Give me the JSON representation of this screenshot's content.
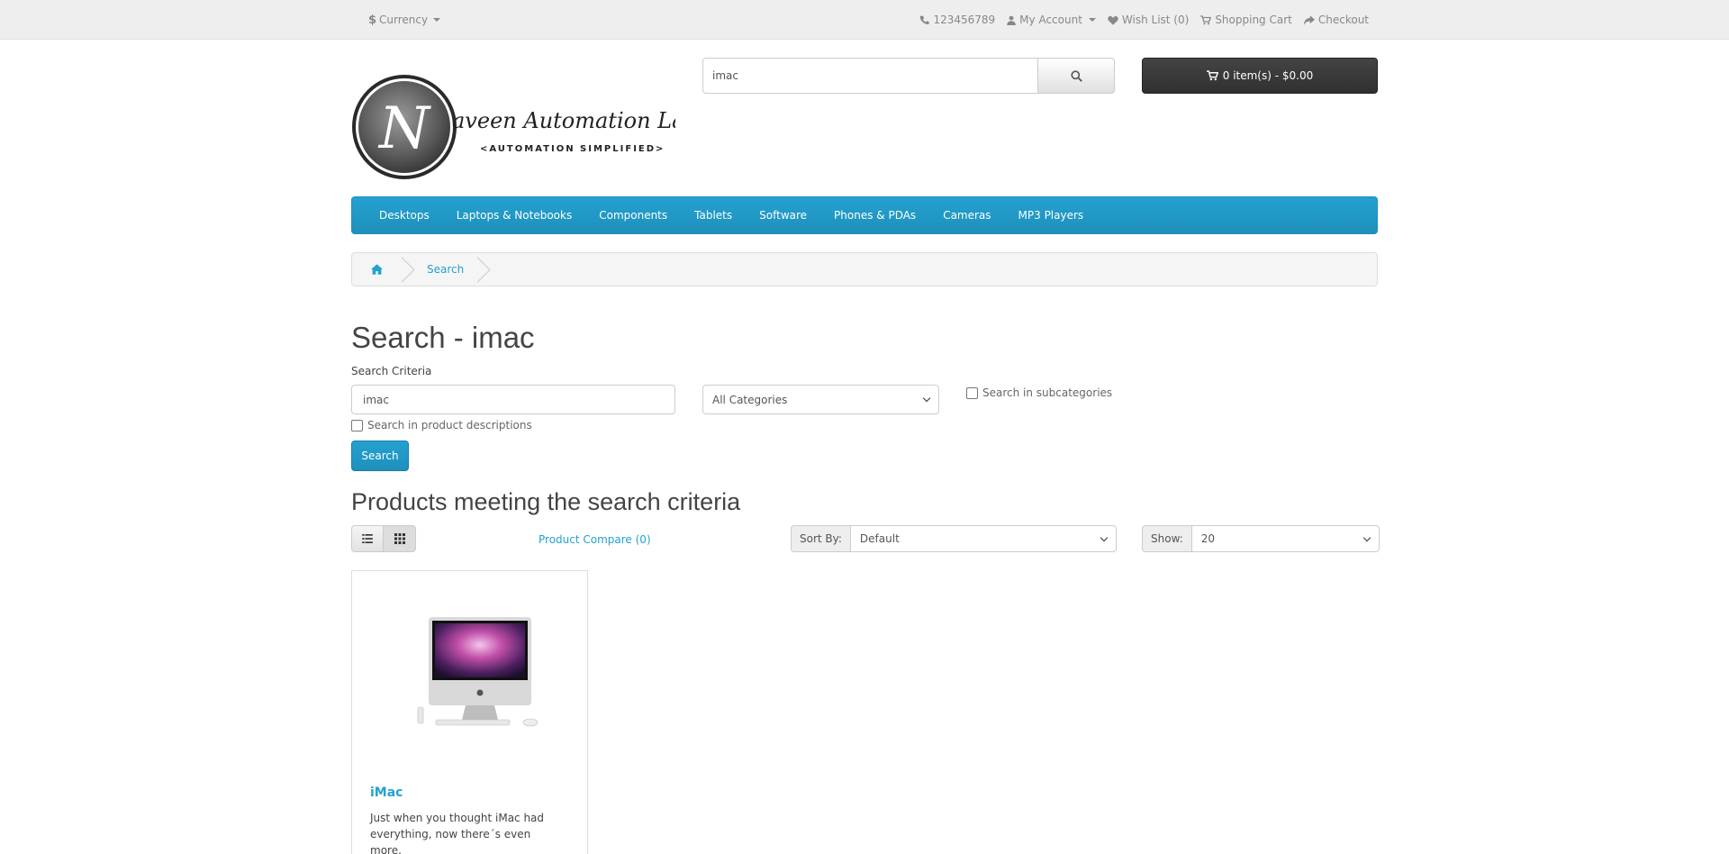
{
  "top": {
    "currency_label": "Currency",
    "currency_symbol": "$",
    "phone": "123456789",
    "my_account": "My Account",
    "wish_list": "Wish List (0)",
    "shopping_cart": "Shopping Cart",
    "checkout": "Checkout"
  },
  "header": {
    "logo_initial": "N",
    "logo_text": "aveen Automation Labs",
    "logo_tagline": "<AUTOMATION SIMPLIFIED>",
    "search_value": "imac",
    "cart_label": "0 item(s) - $0.00"
  },
  "menu": {
    "items": [
      "Desktops",
      "Laptops & Notebooks",
      "Components",
      "Tablets",
      "Software",
      "Phones & PDAs",
      "Cameras",
      "MP3 Players"
    ]
  },
  "breadcrumb": {
    "current": "Search"
  },
  "page": {
    "title": "Search - imac",
    "criteria_label": "Search Criteria",
    "criteria_value": "imac",
    "category_selected": "All Categories",
    "subcategories_label": "Search in subcategories",
    "descriptions_label": "Search in product descriptions",
    "search_button": "Search",
    "results_heading": "Products meeting the search criteria",
    "compare_link": "Product Compare (0)",
    "sort_label": "Sort By:",
    "sort_value": "Default",
    "show_label": "Show:",
    "show_value": "20"
  },
  "products": [
    {
      "name": "iMac",
      "description": "Just when you thought iMac had everything, now there´s even more."
    }
  ],
  "colors": {
    "accent": "#23a1d1",
    "topbar": "#eeeeee",
    "cart_button": "#363636"
  },
  "icons": {
    "phone": "phone-icon",
    "account": "user-icon",
    "wishlist": "heart-icon",
    "cart": "cart-icon",
    "checkout": "share-icon",
    "search": "search-icon",
    "home": "home-icon",
    "list": "list-view-icon",
    "grid": "grid-view-icon"
  }
}
